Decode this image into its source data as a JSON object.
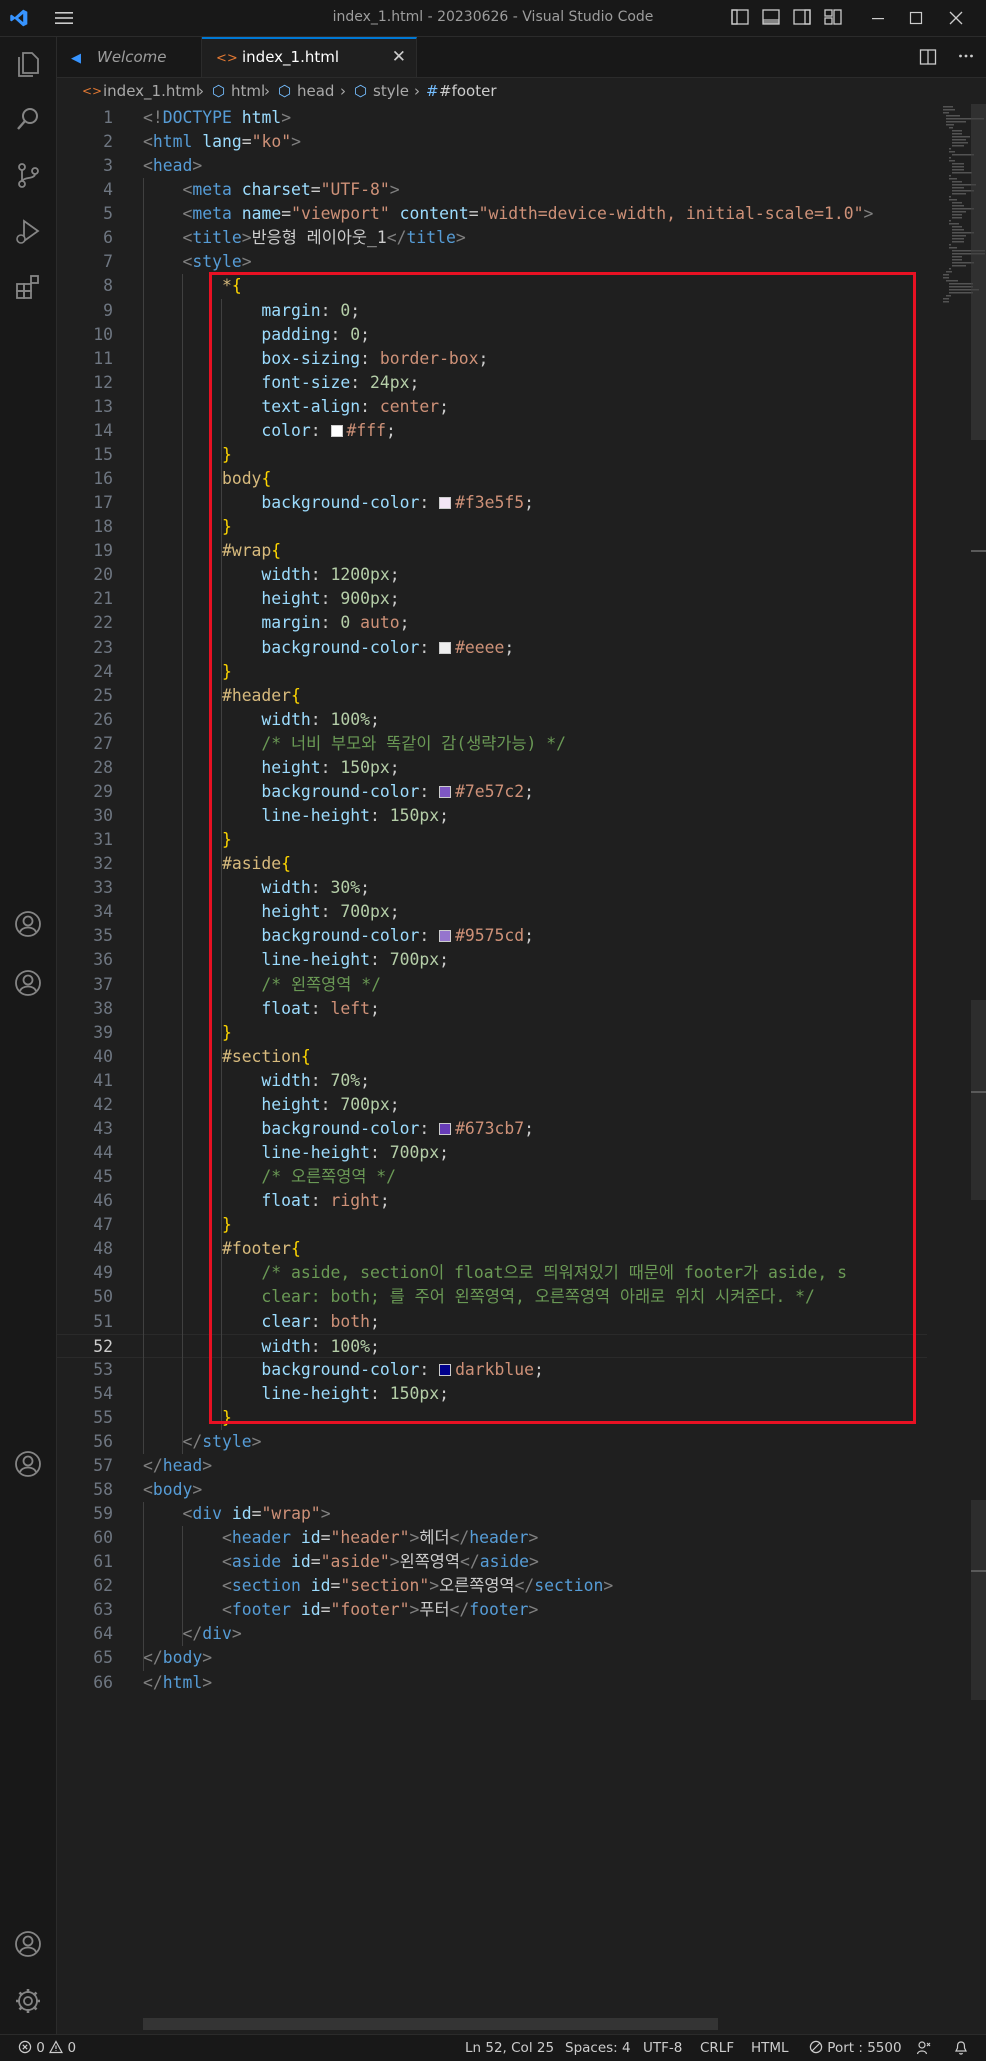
{
  "window": {
    "title": "index_1.html - 20230626 - Visual Studio Code"
  },
  "tabs": [
    {
      "label": "Welcome",
      "icon": "vscode-icon"
    },
    {
      "label": "index_1.html",
      "icon": "html-file-icon",
      "close": "✕"
    }
  ],
  "breadcrumb": [
    "index_1.html",
    "html",
    "head",
    "style",
    "#footer"
  ],
  "code_lines": [
    "<!DOCTYPE html>",
    "<html lang=\"ko\">",
    "<head>",
    "    <meta charset=\"UTF-8\">",
    "    <meta name=\"viewport\" content=\"width=device-width, initial-scale=1.0\">",
    "    <title>반응형 레이아웃_1</title>",
    "    <style>",
    "        *{",
    "            margin: 0;",
    "            padding: 0;",
    "            box-sizing: border-box;",
    "            font-size: 24px;",
    "            text-align: center;",
    "            color: #fff;",
    "        }",
    "        body{",
    "            background-color: #f3e5f5;",
    "        }",
    "        #wrap{",
    "            width: 1200px;",
    "            height: 900px;",
    "            margin: 0 auto;",
    "            background-color: #eeee;",
    "        }",
    "        #header{",
    "            width: 100%;",
    "            /* 너비 부모와 똑같이 감(생략가능) */",
    "            height: 150px;",
    "            background-color: #7e57c2;",
    "            line-height: 150px;",
    "        }",
    "        #aside{",
    "            width: 30%;",
    "            height: 700px;",
    "            background-color: #9575cd;",
    "            line-height: 700px;",
    "            /* 왼쪽영역 */",
    "            float: left;",
    "        }",
    "        #section{",
    "            width: 70%;",
    "            height: 700px;",
    "            background-color: #673cb7;",
    "            line-height: 700px;",
    "            /* 오른쪽영역 */",
    "            float: right;",
    "        }",
    "        #footer{",
    "            /* aside, section이 float으로 띄워져있기 때문에 footer가 aside, s",
    "            clear: both; 를 주어 왼쪽영역, 오른쪽영역 아래로 위치 시켜준다. */",
    "            clear: both;",
    "            width: 100%;",
    "            background-color: darkblue;",
    "            line-height: 150px;",
    "        }",
    "    </style>",
    "</head>",
    "<body>",
    "    <div id=\"wrap\">",
    "        <header id=\"header\">헤더</header>",
    "        <aside id=\"aside\">왼쪽영역</aside>",
    "        <section id=\"section\">오른쪽영역</section>",
    "        <footer id=\"footer\">푸터</footer>",
    "    </div>",
    "</body>",
    "</html>"
  ],
  "current_line": 52,
  "color_swatches": {
    "14": "#ffffff",
    "17": "#f3e5f5",
    "23": "#eeeeee",
    "29": "#7e57c2",
    "35": "#9575cd",
    "43": "#673cb7",
    "53": "#00008b"
  },
  "status": {
    "errors": "0",
    "warnings": "0",
    "position": "Ln 52, Col 25",
    "spaces": "Spaces: 4",
    "encoding": "UTF-8",
    "eol": "CRLF",
    "language": "HTML",
    "port": "Port : 5500"
  },
  "colors": {
    "accent": "#0078d4",
    "highlight_box": "#e81123",
    "editor_bg": "#1f1f1f"
  }
}
